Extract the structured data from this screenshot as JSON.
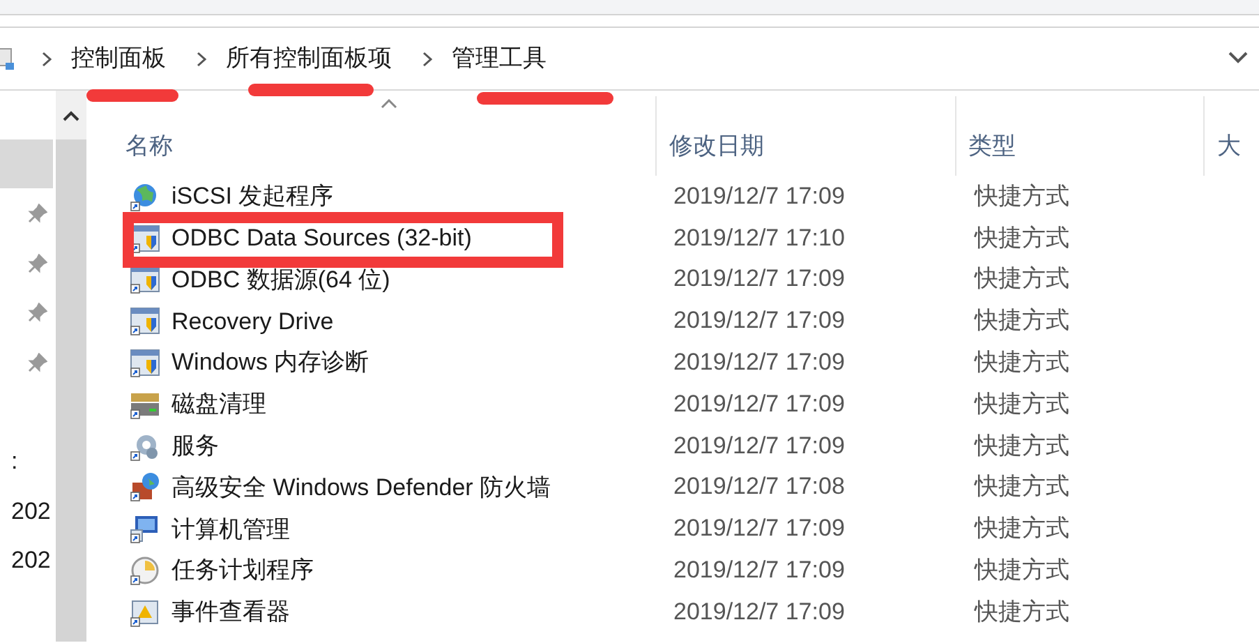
{
  "address_bar": {
    "crumbs": [
      "控制面板",
      "所有控制面板项",
      "管理工具"
    ]
  },
  "nav_pane": {
    "items": [
      {
        "kind": "highlight"
      },
      {
        "kind": "pin"
      },
      {
        "kind": "pin"
      },
      {
        "kind": "pin"
      },
      {
        "kind": "pin"
      },
      {
        "kind": "blank"
      },
      {
        "kind": "text",
        "text": ":"
      },
      {
        "kind": "text",
        "text": "202"
      },
      {
        "kind": "text",
        "text": "202"
      }
    ]
  },
  "table": {
    "columns": [
      {
        "label": "名称",
        "sorted": true
      },
      {
        "label": "修改日期",
        "sorted": false
      },
      {
        "label": "类型",
        "sorted": false
      },
      {
        "label": "大",
        "sorted": false
      }
    ],
    "rows": [
      {
        "kind": "globe",
        "name": "iSCSI 发起程序",
        "modified": "2019/12/7 17:09",
        "type": "快捷方式"
      },
      {
        "kind": "shield",
        "name": "ODBC Data Sources (32-bit)",
        "modified": "2019/12/7 17:10",
        "type": "快捷方式"
      },
      {
        "kind": "shield",
        "name": "ODBC 数据源(64 位)",
        "modified": "2019/12/7 17:09",
        "type": "快捷方式"
      },
      {
        "kind": "shield",
        "name": "Recovery Drive",
        "modified": "2019/12/7 17:09",
        "type": "快捷方式"
      },
      {
        "kind": "shield",
        "name": "Windows 内存诊断",
        "modified": "2019/12/7 17:09",
        "type": "快捷方式"
      },
      {
        "kind": "disk",
        "name": "磁盘清理",
        "modified": "2019/12/7 17:09",
        "type": "快捷方式"
      },
      {
        "kind": "gears",
        "name": "服务",
        "modified": "2019/12/7 17:09",
        "type": "快捷方式"
      },
      {
        "kind": "firewall",
        "name": "高级安全 Windows Defender 防火墙",
        "modified": "2019/12/7 17:08",
        "type": "快捷方式"
      },
      {
        "kind": "computer",
        "name": "计算机管理",
        "modified": "2019/12/7 17:09",
        "type": "快捷方式"
      },
      {
        "kind": "clock",
        "name": "任务计划程序",
        "modified": "2019/12/7 17:09",
        "type": "快捷方式"
      },
      {
        "kind": "log",
        "name": "事件查看器",
        "modified": "2019/12/7 17:09",
        "type": "快捷方式"
      }
    ]
  }
}
